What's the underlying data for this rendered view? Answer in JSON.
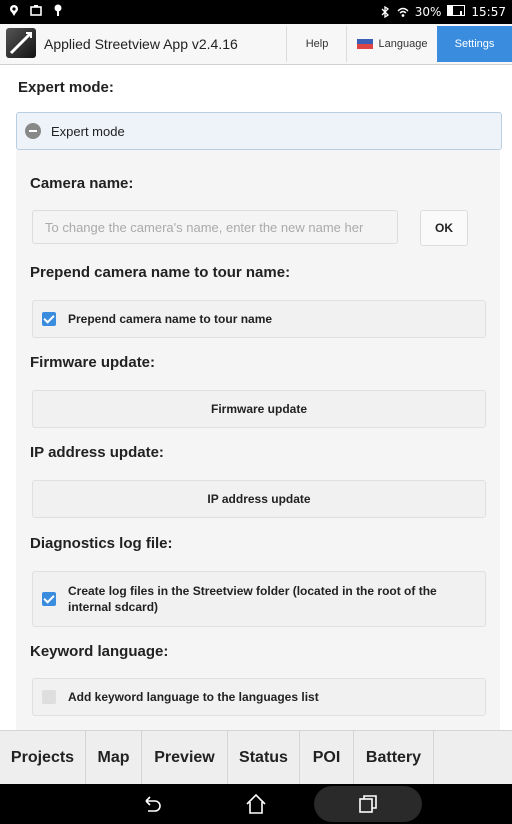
{
  "status_bar": {
    "left_icons": [
      "location-icon",
      "briefcase-icon",
      "shield-icon"
    ],
    "right_icons": [
      "bluetooth-icon",
      "wifi-icon",
      "battery-icon"
    ],
    "battery_percent": "30%",
    "time": "15:57"
  },
  "header": {
    "app_title": "Applied Streetview App v2.4.16",
    "help_label": "Help",
    "language_label": "Language",
    "settings_label": "Settings",
    "accent_color": "#3a8dde"
  },
  "main": {
    "page_title": "Expert mode:",
    "collapsible_label": "Expert mode",
    "camera_name": {
      "label": "Camera name:",
      "input_value": "",
      "input_placeholder": "To change the camera's name, enter the new name her",
      "ok_label": "OK"
    },
    "prepend": {
      "label": "Prepend camera name to tour name:",
      "checkbox_label": "Prepend camera name to tour name",
      "checked": true
    },
    "firmware": {
      "label": "Firmware update:",
      "button_label": "Firmware update"
    },
    "ip_address": {
      "label": "IP address update:",
      "button_label": "IP address update"
    },
    "diagnostics": {
      "label": "Diagnostics log file:",
      "checkbox_label": "Create log files in the Streetview folder (located in the root of the internal sdcard)",
      "checked": true
    },
    "keyword_language": {
      "label": "Keyword language:",
      "checkbox_label": "Add keyword language to the languages list",
      "checked": false
    }
  },
  "tabs": [
    {
      "label": "Projects"
    },
    {
      "label": "Map"
    },
    {
      "label": "Preview"
    },
    {
      "label": "Status"
    },
    {
      "label": "POI"
    },
    {
      "label": "Battery"
    }
  ],
  "nav_bar": {
    "icons": [
      "back-icon",
      "home-icon",
      "recents-icon"
    ]
  }
}
